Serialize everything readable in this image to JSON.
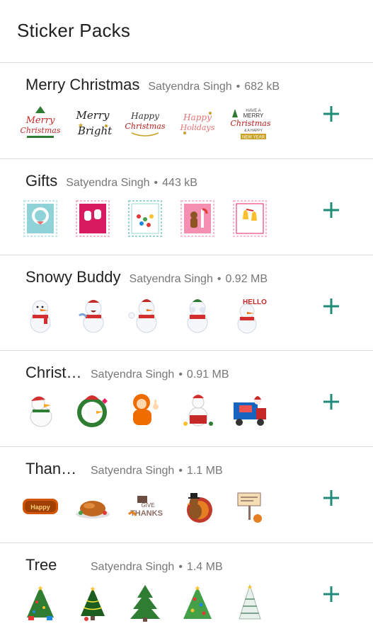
{
  "app": {
    "title": "Sticker Packs"
  },
  "accent_color": "#1f8c7a",
  "packs": [
    {
      "title": "Merry Christmas",
      "author": "Satyendra Singh",
      "size": "682 kB",
      "stickers": [
        "merry-christmas-text-icon",
        "merry-bright-text-icon",
        "happy-christmas-text-icon",
        "happy-holidays-text-icon",
        "merry-christmas-new-year-text-icon"
      ]
    },
    {
      "title": "Gifts",
      "author": "Satyendra Singh",
      "size": "443 kB",
      "stickers": [
        "wreath-stamp-icon",
        "mittens-stamp-icon",
        "ornaments-stamp-icon",
        "gingerbread-stamp-icon",
        "bells-stamp-icon"
      ]
    },
    {
      "title": "Snowy Buddy",
      "author": "Satyendra Singh",
      "size": "0.92 MB",
      "stickers": [
        "snowman-wave-icon",
        "snowman-laugh-icon",
        "snowman-thumbs-up-icon",
        "snowman-cover-face-icon",
        "snowman-hello-icon"
      ]
    },
    {
      "title": "Christ…",
      "author": "Satyendra Singh",
      "size": "0.91 MB",
      "stickers": [
        "santa-goose-icon",
        "goose-wreath-icon",
        "orange-jacket-icon",
        "goose-reading-icon",
        "santa-truck-icon"
      ]
    },
    {
      "title": "Than…",
      "author": "Satyendra Singh",
      "size": "1.1 MB",
      "stickers": [
        "happy-thanksgiving-text-icon",
        "roast-turkey-icon",
        "give-thanks-text-icon",
        "turkey-pilgrim-icon",
        "thanksgiving-sign-icon"
      ]
    },
    {
      "title": "Tree",
      "author": "Satyendra Singh",
      "size": "1.4 MB",
      "stickers": [
        "decorated-tree-icon",
        "light-tree-icon",
        "green-tree-icon",
        "ornament-tree-icon",
        "snowy-tree-icon"
      ]
    }
  ]
}
